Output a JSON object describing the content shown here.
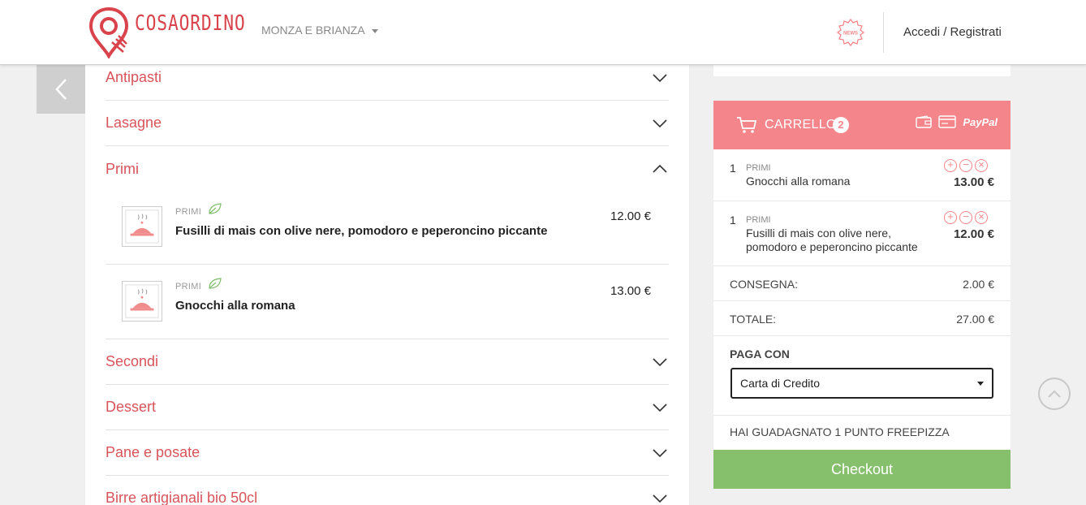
{
  "header": {
    "brand": "COSAORDINO",
    "region": "MONZA E BRIANZA",
    "news_icon": "news-badge-icon",
    "login": "Accedi / Registrati"
  },
  "menu": {
    "categories_before": [
      {
        "label": "Antipasti",
        "icon": "chevron-down-icon"
      },
      {
        "label": "Lasagne",
        "icon": "chevron-down-icon"
      }
    ],
    "open_category": {
      "label": "Primi",
      "icon": "chevron-up-icon"
    },
    "dishes": [
      {
        "category": "PRIMI",
        "name": "Fusilli di mais con olive nere, pomodoro e peperoncino piccante",
        "price": "12.00 €",
        "icon": "leaf-icon"
      },
      {
        "category": "PRIMI",
        "name": "Gnocchi alla romana",
        "price": "13.00 €",
        "icon": "leaf-icon"
      }
    ],
    "categories_after": [
      {
        "label": "Secondi",
        "icon": "chevron-down-icon"
      },
      {
        "label": "Dessert",
        "icon": "chevron-down-icon"
      },
      {
        "label": "Pane e posate",
        "icon": "chevron-down-icon"
      },
      {
        "label": "Birre artigianali bio 50cl",
        "icon": "chevron-down-icon"
      }
    ]
  },
  "cart": {
    "title": "CARRELLO",
    "count": "2",
    "paypal": "PayPal",
    "items": [
      {
        "qty": "1",
        "category": "PRIMI",
        "name": "Gnocchi alla romana",
        "price": "13.00 €"
      },
      {
        "qty": "1",
        "category": "PRIMI",
        "name": "Fusilli di mais con olive nere, pomodoro e peperoncino piccante",
        "price": "12.00 €"
      }
    ],
    "delivery_label": "CONSEGNA:",
    "delivery_value": "2.00 €",
    "total_label": "TOTALE:",
    "total_value": "27.00 €",
    "pay_with_label": "PAGA CON",
    "pay_method": "Carta di Credito",
    "points_text": "HAI GUADAGNATO 1 PUNTO FREEPIZZA",
    "checkout_label": "Checkout"
  },
  "colors": {
    "brand_red": "#d9434b",
    "cart_pink": "#f4858a",
    "checkout_green": "#86c06c"
  }
}
